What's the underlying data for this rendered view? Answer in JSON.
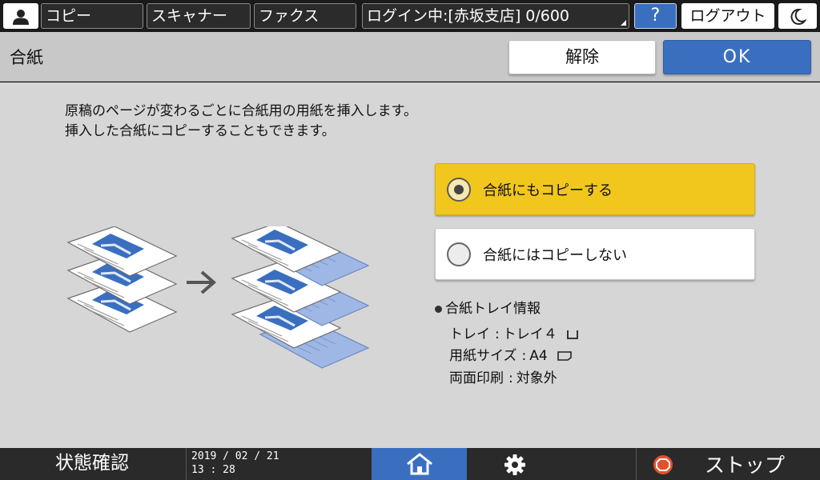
{
  "topbar": {
    "user_icon": "person-icon",
    "copy_label": "コピー",
    "scanner_label": "スキャナー",
    "fax_label": "ファクス",
    "login_status": "ログイン中:[赤坂支店] 0/600",
    "help_label": "?",
    "logout_label": "ログアウト",
    "energy_icon": "moon-icon"
  },
  "header": {
    "title": "合紙",
    "release_label": "解除",
    "ok_label": "OK"
  },
  "main": {
    "description_line1": "原稿のページが変わるごとに合紙用の用紙を挿入します。",
    "description_line2": "挿入した合紙にコピーすることもできます。",
    "options": [
      {
        "label": "合紙にもコピーする",
        "selected": true
      },
      {
        "label": "合紙にはコピーしない",
        "selected": false
      }
    ],
    "info": {
      "heading": "合紙トレイ情報",
      "tray_label": "トレイ",
      "tray_value": "トレイ４",
      "size_label": "用紙サイズ",
      "size_value": "A4",
      "duplex_label": "両面印刷",
      "duplex_value": "対象外"
    }
  },
  "bottombar": {
    "status_label": "状態確認",
    "date": "2019 / 02 / 21",
    "time": "13 : 28",
    "stop_label": "ストップ"
  },
  "colors": {
    "accent_blue": "#3a6fc0",
    "selected_yellow": "#f2c71d",
    "stop_red": "#e4502a"
  }
}
